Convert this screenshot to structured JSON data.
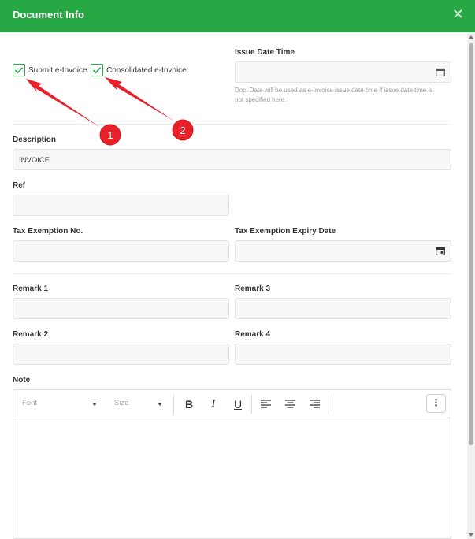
{
  "header": {
    "title": "Document Info",
    "close_icon": "close-icon"
  },
  "checkboxes": [
    {
      "label": "Submit e-Invoice",
      "checked": true
    },
    {
      "label": "Consolidated e-Invoice",
      "checked": true
    }
  ],
  "issue_date": {
    "label": "Issue Date Time",
    "value": "",
    "hint_line1": "Doc. Date will be used as e-Invoice issue date time if issue date time is",
    "hint_line2": "not specified here.",
    "icon": "calendar-icon"
  },
  "description": {
    "label": "Description",
    "value": "INVOICE"
  },
  "ref": {
    "label": "Ref",
    "value": ""
  },
  "tax_exemption_no": {
    "label": "Tax Exemption No.",
    "value": ""
  },
  "tax_exemption_expiry": {
    "label": "Tax Exemption Expiry Date",
    "value": "",
    "icon": "calendar-icon"
  },
  "remarks": {
    "remark1": {
      "label": "Remark 1",
      "value": ""
    },
    "remark2": {
      "label": "Remark 2",
      "value": ""
    },
    "remark3": {
      "label": "Remark 3",
      "value": ""
    },
    "remark4": {
      "label": "Remark 4",
      "value": ""
    }
  },
  "note": {
    "label": "Note",
    "toolbar": {
      "font_placeholder": "Font",
      "size_placeholder": "Size",
      "bold": "B",
      "italic": "I",
      "underline": "U",
      "more": "⋮"
    }
  },
  "annotations": [
    {
      "number": "1"
    },
    {
      "number": "2"
    }
  ],
  "colors": {
    "accent": "#27a845",
    "annotation": "#e8202a"
  }
}
